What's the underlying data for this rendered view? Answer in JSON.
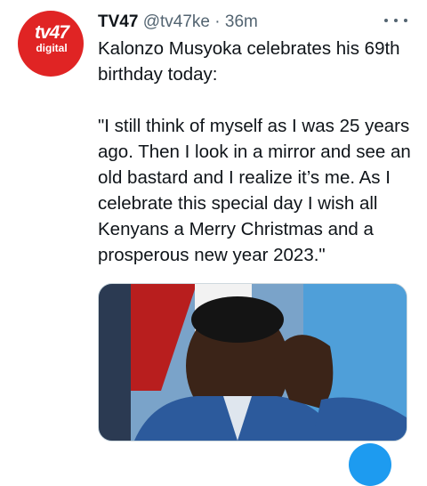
{
  "tweet": {
    "display_name": "TV47",
    "handle": "@tv47ke",
    "separator": "·",
    "time": "36m",
    "text_line1": "Kalonzo Musyoka celebrates his 69th birthday today:",
    "text_quote": "\"I still think of myself as I was 25 years ago. Then I look in a mirror and see an old bastard and I realize it’s me. As I celebrate this special day I wish all Kenyans a Merry Christmas and a prosperous new year 2023.\"",
    "avatar": {
      "logo_top": "tv47",
      "logo_bottom": "digital",
      "color": "#e02424"
    },
    "more_icon": "more-horizontal-icon",
    "media_description_icon": "photo"
  },
  "colors": {
    "accent": "#1d9bf0",
    "text_primary": "#0f1419",
    "text_secondary": "#536471"
  }
}
